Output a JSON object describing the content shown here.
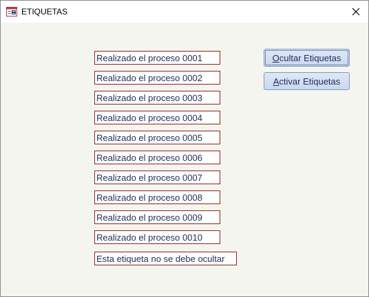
{
  "window": {
    "title": "ETIQUETAS",
    "icon": "form-icon",
    "close_icon": "close-icon"
  },
  "labels": [
    "Realizado el proceso 0001",
    "Realizado el proceso 0002",
    "Realizado el proceso 0003",
    "Realizado el proceso 0004",
    "Realizado el proceso 0005",
    "Realizado el proceso 0006",
    "Realizado el proceso 0007",
    "Realizado el proceso 0008",
    "Realizado el proceso 0009",
    "Realizado el proceso 0010"
  ],
  "persistent_label": "Esta etiqueta no se debe ocultar",
  "buttons": {
    "hide": {
      "accel": "O",
      "rest": "cultar Etiquetas"
    },
    "show": {
      "accel": "A",
      "rest": "ctivar Etiquetas"
    }
  },
  "colors": {
    "label_border": "#8b2323",
    "label_text": "#1f2d5a",
    "form_background": "#f5f5ef",
    "button_border": "#7a98c7"
  }
}
